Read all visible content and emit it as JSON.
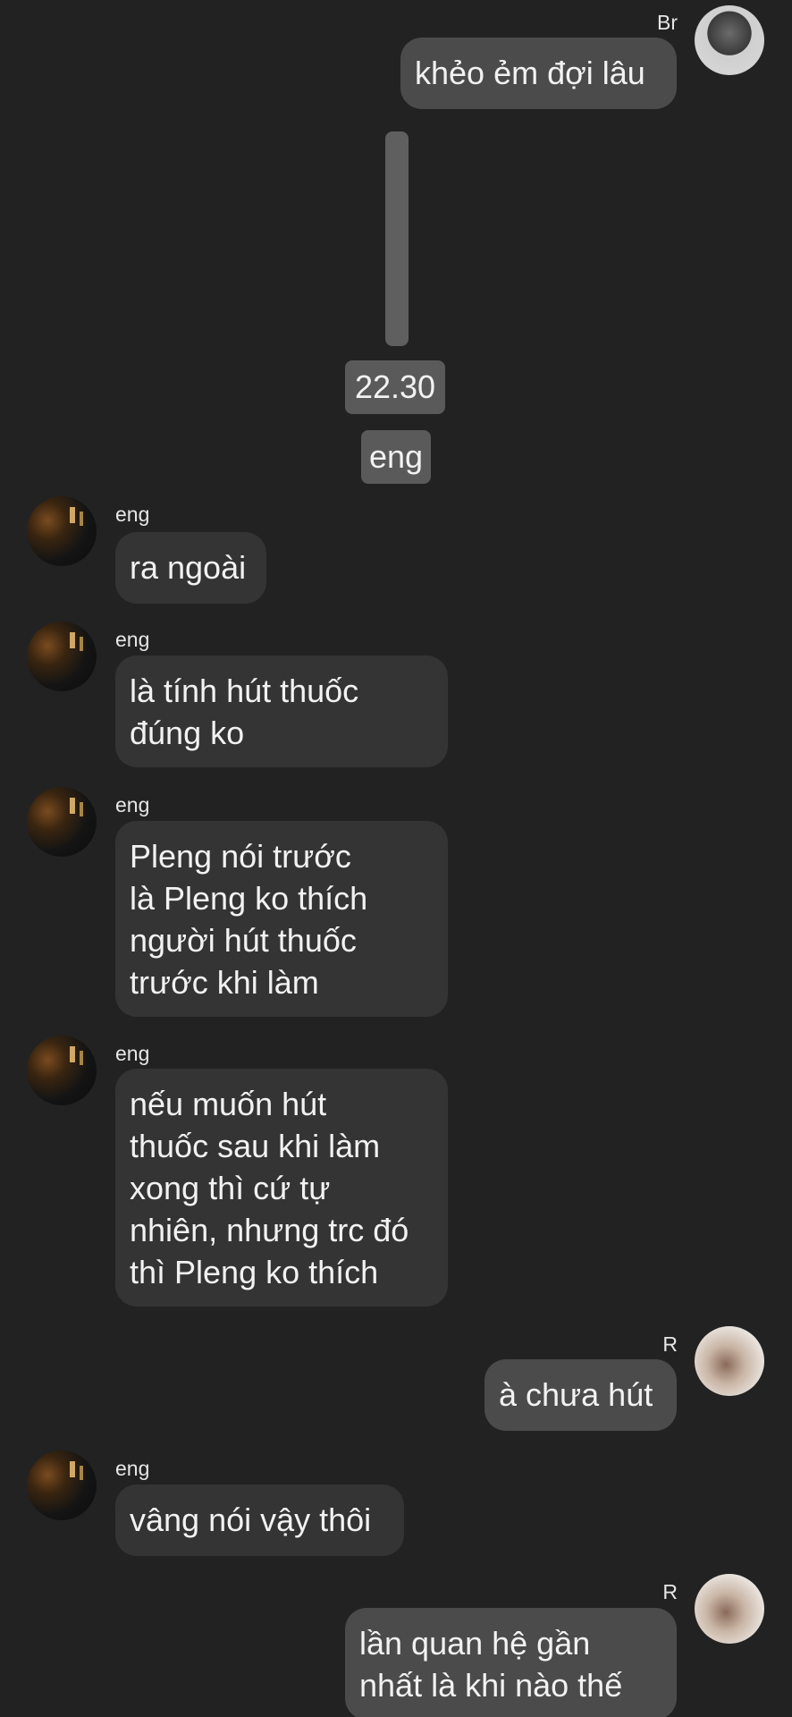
{
  "messages": [
    {
      "sender": "Br",
      "text": "khẻo ẻm đợi lâu"
    },
    {
      "time": "22.30",
      "name_chip": "eng"
    },
    {
      "sender": "eng",
      "text": "ra ngoài"
    },
    {
      "sender": "eng",
      "text": "là tính hút thuốc\nđúng ko"
    },
    {
      "sender": "eng",
      "text": "Pleng nói trước\nlà Pleng ko thích\nngười hút thuốc\ntrước khi làm"
    },
    {
      "sender": "eng",
      "text": "nếu muốn hút\nthuốc sau khi làm\nxong thì cứ tự\nnhiên, nhưng trc đó\nthì Pleng ko thích"
    },
    {
      "sender": "R",
      "text": "à chưa hút"
    },
    {
      "sender": "eng",
      "text": "vâng nói vậy thôi"
    },
    {
      "sender": "R",
      "text": "lần quan hệ gần\nnhất là khi nào thế"
    }
  ]
}
